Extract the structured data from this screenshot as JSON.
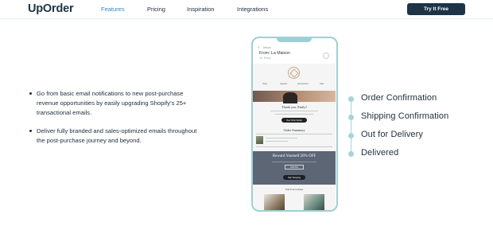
{
  "header": {
    "logo": "UpOrder",
    "nav": [
      "Features",
      "Pricing",
      "Inspiration",
      "Integrations"
    ],
    "cta": "Try It Free"
  },
  "bullets": [
    "Go from basic email notifications to new post-purchase revenue opportunities by easily upgrading Shopify’s 25+ transactional emails.",
    "Deliver fully branded and sales-optimized emails throughout the post-purchase journey and beyond."
  ],
  "phone": {
    "inbox": "Inbox",
    "from": "From: La Maison",
    "to": "To: Emily",
    "email_nav": [
      "Shop",
      "Apparel",
      "Accessories",
      "Sale"
    ],
    "thank_you": "Thank you, Emily!",
    "view_button": "View Order Details",
    "order_summary": "Order Summary",
    "promo_title": "Reward Yourself 20% OFF",
    "promo_code": "FIRST20",
    "promo_button": "Start Shopping",
    "love": "You'll love these"
  },
  "timeline": [
    "Order Confirmation",
    "Shipping Confirmation",
    "Out for Delivery",
    "Delivered"
  ],
  "colors": {
    "brand_dark": "#1c3446",
    "accent_link": "#2f8bbf",
    "phone_frame": "#9fcfd6",
    "promo_bg": "#5c6675"
  }
}
